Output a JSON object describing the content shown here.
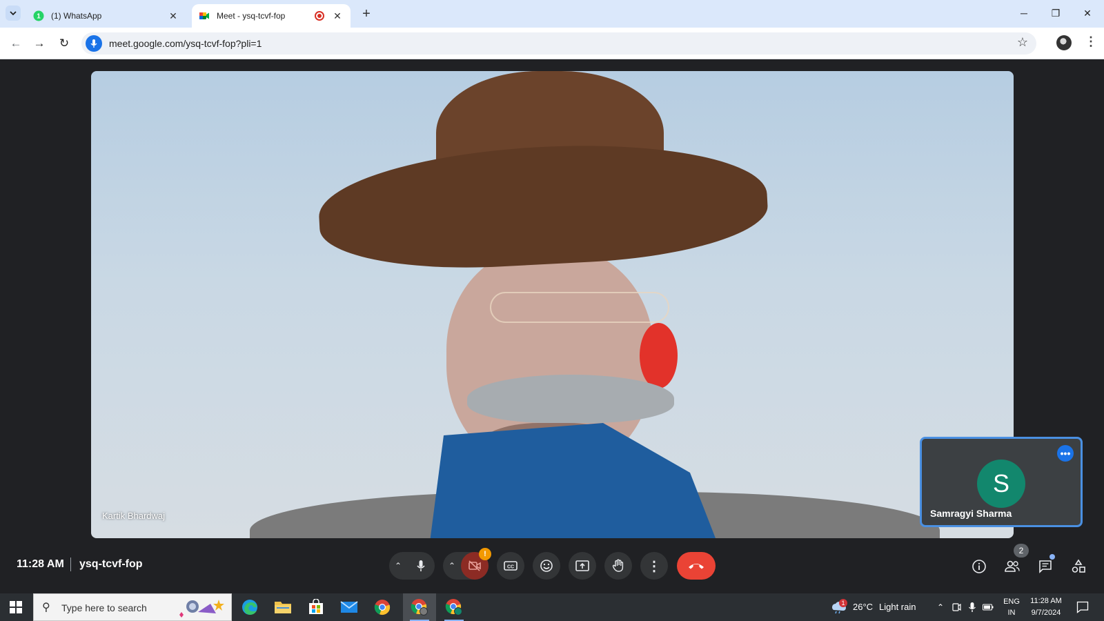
{
  "browser": {
    "tabs": [
      {
        "label": "(1) WhatsApp",
        "active": false
      },
      {
        "label": "Meet - ysq-tcvf-fop",
        "active": true
      }
    ],
    "url": "meet.google.com/ysq-tcvf-fop?pli=1"
  },
  "meet": {
    "main_participant": "Kartik Bhardwaj",
    "self_tile": {
      "name": "Samragyi Sharma",
      "avatar_letter": "S",
      "avatar_color": "#12876d"
    },
    "bar": {
      "time": "11:28 AM",
      "meeting_code": "ysq-tcvf-fop",
      "camera_warning": "!",
      "participants_count": "2"
    },
    "colors": {
      "leave": "#ea4335",
      "accent": "#1a73e8",
      "camera_off": "#8c2b24"
    }
  },
  "taskbar": {
    "search_placeholder": "Type here to search",
    "weather": {
      "temp": "26°C",
      "condition": "Light rain",
      "alert_count": "1"
    },
    "language": {
      "lang": "ENG",
      "region": "IN"
    },
    "clock": {
      "time": "11:28 AM",
      "date": "9/7/2024"
    }
  }
}
